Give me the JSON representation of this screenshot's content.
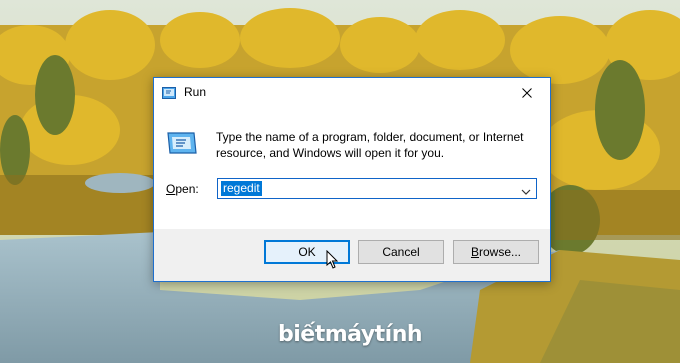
{
  "window": {
    "title": "Run",
    "description": "Type the name of a program, folder, document, or Internet resource, and Windows will open it for you.",
    "open_label_prefix": "O",
    "open_label_rest": "pen:",
    "open_value": "regedit",
    "ok_label": "OK",
    "cancel_label": "Cancel",
    "browse_label_prefix": "B",
    "browse_label_rest": "rowse..."
  },
  "icons": {
    "title": "run-icon",
    "app": "run-app-icon",
    "close": "close-icon",
    "dropdown": "chevron-down-icon",
    "cursor": "mouse-pointer-icon"
  },
  "watermark": {
    "text": "biếtmáytính"
  },
  "colors": {
    "accent": "#0078d7",
    "dialog_border": "#1e6fce",
    "button_face": "#e1e1e1"
  }
}
